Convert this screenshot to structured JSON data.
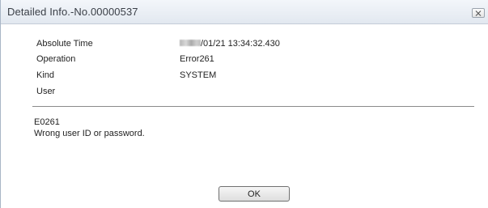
{
  "window": {
    "title": "Detailed Info.-No.00000537",
    "close_icon": "close-icon"
  },
  "details": [
    {
      "label": "Absolute Time",
      "value": "/01/21 13:34:32.430",
      "value_prefix_masked": true
    },
    {
      "label": "Operation",
      "value": "Error261"
    },
    {
      "label": "Kind",
      "value": "SYSTEM"
    },
    {
      "label": "User",
      "value": ""
    }
  ],
  "message": {
    "code": "E0261",
    "text": "Wrong user ID or password."
  },
  "buttons": {
    "ok_label": "OK"
  }
}
